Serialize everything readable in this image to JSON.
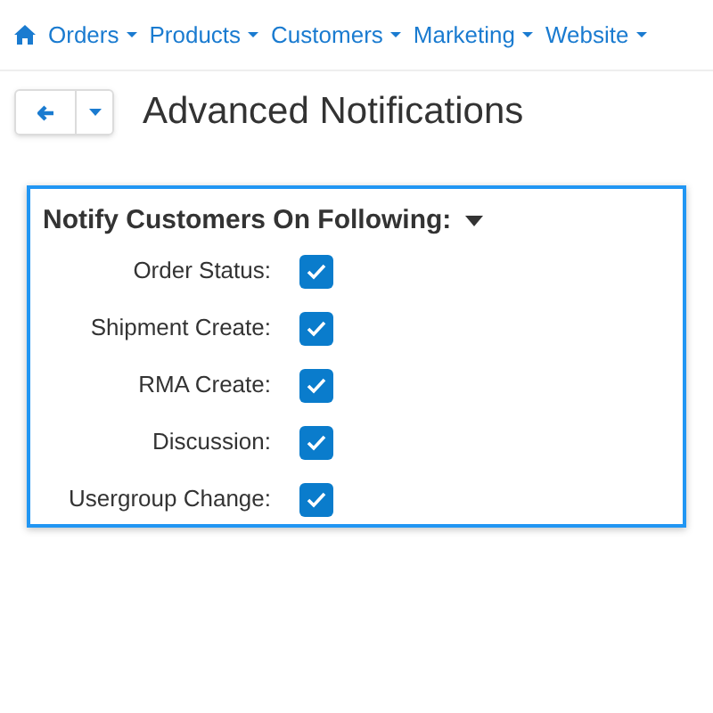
{
  "nav": [
    {
      "label": "Orders"
    },
    {
      "label": "Products"
    },
    {
      "label": "Customers"
    },
    {
      "label": "Marketing"
    },
    {
      "label": "Website"
    }
  ],
  "page_title": "Advanced Notifications",
  "section": {
    "title": "Notify Customers On Following:",
    "expanded": true,
    "options": [
      {
        "label": "Order Status:",
        "checked": true
      },
      {
        "label": "Shipment Create:",
        "checked": true
      },
      {
        "label": "RMA Create:",
        "checked": true
      },
      {
        "label": "Discussion:",
        "checked": true
      },
      {
        "label": "Usergroup Change:",
        "checked": true
      }
    ]
  }
}
